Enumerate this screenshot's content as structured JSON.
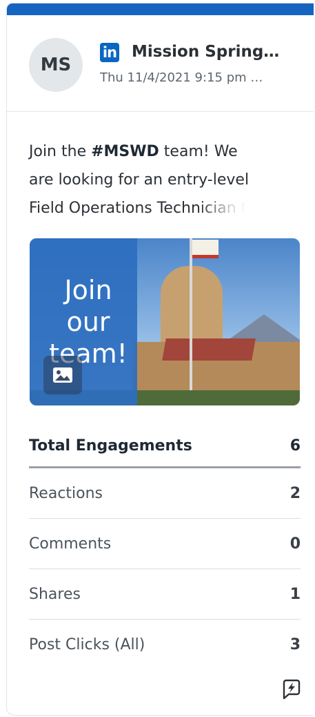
{
  "post": {
    "avatar_initials": "MS",
    "network_icon": "linkedin-icon",
    "network_icon_glyph": "in",
    "author": "Mission Spring…",
    "timestamp": "Thu 11/4/2021 9:15 pm …",
    "text_prefix": "Join the ",
    "hashtag": "#MSWD",
    "text_line1_rest": " team! We",
    "text_line2": "are looking for an entry-level",
    "text_line3": "Field Operations Technician t",
    "image_overlay_text": "Join our team!",
    "image_icon": "image-icon"
  },
  "stats": {
    "total_label": "Total Engagements",
    "total_value": "6",
    "rows": [
      {
        "label": "Reactions",
        "value": "2"
      },
      {
        "label": "Comments",
        "value": "0"
      },
      {
        "label": "Shares",
        "value": "1"
      },
      {
        "label": "Post Clicks (All)",
        "value": "3"
      }
    ]
  },
  "footer": {
    "action_icon": "quick-reply-icon"
  },
  "colors": {
    "accent_bar": "#1565c0",
    "linkedin": "#0a66c2",
    "avatar_bg": "#e4e7ea"
  }
}
